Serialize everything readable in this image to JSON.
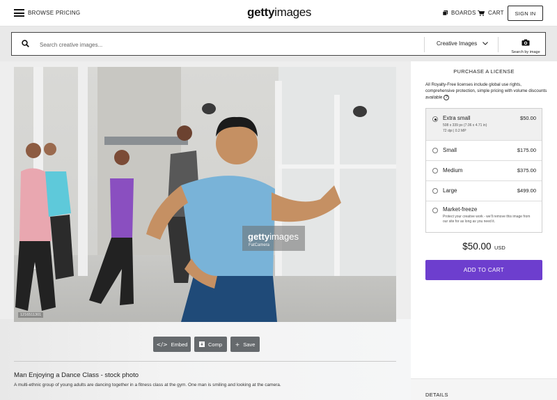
{
  "header": {
    "browse": "BROWSE",
    "pricing": "PRICING",
    "logo_bold": "getty",
    "logo_light": "images",
    "boards": "BOARDS",
    "cart": "CART",
    "sign_in": "SIGN IN"
  },
  "search": {
    "placeholder": "Search creative images...",
    "type": "Creative Images",
    "search_by_image": "Search by image",
    "icons": [
      "search-icon",
      "chevron-down-icon",
      "camera-icon"
    ]
  },
  "photo": {
    "watermark_bold": "getty",
    "watermark_light": "images",
    "credit": "FatCamera",
    "id": "1216511301"
  },
  "actions": {
    "embed": "Embed",
    "comp": "Comp",
    "save": "Save"
  },
  "details": {
    "title": "Man Enjoying a Dance Class - stock photo",
    "description": "A multi-ethnic group of young adults are dancing together in a fitness class at the gym. One man is smiling and looking at the camera."
  },
  "license": {
    "title": "PURCHASE A LICENSE",
    "info": "All Royalty-Free licenses include global use rights, comprehensive protection, simple pricing with volume discounts available",
    "options": [
      {
        "name": "Extra small",
        "price": "$50.00",
        "sub1": "508 x 339 px (7.06 x 4.71 in)",
        "sub2": "72 dpi | 0.2 MP",
        "selected": true
      },
      {
        "name": "Small",
        "price": "$175.00"
      },
      {
        "name": "Medium",
        "price": "$375.00"
      },
      {
        "name": "Large",
        "price": "$499.00"
      },
      {
        "name": "Market-freeze",
        "price": "",
        "sub1": "Protect your creative work - we'll remove this image from our site for as long as you need it."
      }
    ],
    "total_amount": "$50.00",
    "total_currency": "USD",
    "add_to_cart": "ADD TO CART",
    "details_heading": "DETAILS"
  },
  "colors": {
    "accent": "#6d3ece",
    "action_button": "#666a6d"
  }
}
